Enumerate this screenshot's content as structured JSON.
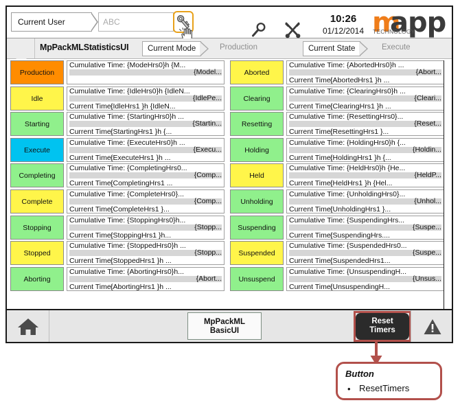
{
  "header": {
    "user_label": "Current User",
    "user_value": "",
    "user_placeholder": "ABC",
    "key_icon": "key-icon",
    "cursor_icon": "hand-cursor-icon",
    "search_icon": "magnifier-icon",
    "tools_icon": "wrench-tools-icon",
    "time": "10:26",
    "date": "01/12/2014",
    "logo_m": "m",
    "logo_app": "app",
    "logo_sub": "TECHNOLOGY"
  },
  "breadcrumb": {
    "screen_title": "MpPackMLStatisticsUI",
    "mode_tag": "Current Mode",
    "mode_value": "Production",
    "state_tag": "Current State",
    "state_value": "Execute"
  },
  "labels": {
    "cumulative": "Cumulative Time:",
    "current": "Current Time:"
  },
  "left_rows": [
    {
      "name": "Production",
      "color": "#FF8C00",
      "line1": "Cumulative Time: {ModeHrs0}h {M...",
      "bar_label": "{Model...",
      "line2_label": "",
      "line2_value": ""
    },
    {
      "name": "Idle",
      "color": "#FFF54A",
      "line1": "Cumulative Time: {IdleHrs0}h {IdleN...",
      "bar_label": "{IdlePe...",
      "line2_label": "Current Time:",
      "line2_value": "{IdleHrs1 }h {IdleN..."
    },
    {
      "name": "Starting",
      "color": "#90F08C",
      "line1": "Cumulative Time: {StartingHrs0}h ...",
      "bar_label": "{Startin...",
      "line2_label": "Current Time:",
      "line2_value": "{StartingHrs1 }h {..."
    },
    {
      "name": "Execute",
      "color": "#00C3F0",
      "line1": "Cumulative Time: {ExecuteHrs0}h ...",
      "bar_label": "{Execu...",
      "line2_label": "Current Time:",
      "line2_value": "{ExecuteHrs1 }h ..."
    },
    {
      "name": "Completing",
      "color": "#90F08C",
      "line1": "Cumulative Time: {CompletingHrs0...",
      "bar_label": "{Comp...",
      "line2_label": "Current Time:",
      "line2_value": "{CompletingHrs1 ..."
    },
    {
      "name": "Complete",
      "color": "#FFF54A",
      "line1": "Cumulative Time: {CompleteHrs0}...",
      "bar_label": "{Comp...",
      "line2_label": "Current Time:",
      "line2_value": "{CompleteHrs1 }..."
    },
    {
      "name": "Stopping",
      "color": "#90F08C",
      "line1": "Cumulative Time: {StoppingHrs0}h...",
      "bar_label": "{Stopp...",
      "line2_label": "Current Time:",
      "line2_value": "{StoppingHrs1 }h..."
    },
    {
      "name": "Stopped",
      "color": "#FFF54A",
      "line1": "Cumulative Time: {StoppedHrs0}h ...",
      "bar_label": "{Stopp...",
      "line2_label": "Current Time:",
      "line2_value": "{StoppedHrs1 }h ..."
    },
    {
      "name": "Aborting",
      "color": "#90F08C",
      "line1": "Cumulative Time: {AbortingHrs0}h...",
      "bar_label": "{Abort...",
      "line2_label": "Current Time:",
      "line2_value": "{AbortingHrs1 }h ..."
    }
  ],
  "right_rows": [
    {
      "name": "Aborted",
      "color": "#FFF54A",
      "line1": "Cumulative Time: {AbortedHrs0}h ...",
      "bar_label": "{Abort...",
      "line2_label": "Current Time:",
      "line2_value": "{AbortedHrs1 }h ..."
    },
    {
      "name": "Clearing",
      "color": "#90F08C",
      "line1": "Cumulative Time: {ClearingHrs0}h ...",
      "bar_label": "{Cleari...",
      "line2_label": "Current Time:",
      "line2_value": "{ClearingHrs1 }h ..."
    },
    {
      "name": "Resetting",
      "color": "#90F08C",
      "line1": "Cumulative Time: {ResettingHrs0}...",
      "bar_label": "{Reset...",
      "line2_label": "Current Time:",
      "line2_value": "{ResettingHrs1 }..."
    },
    {
      "name": "Holding",
      "color": "#90F08C",
      "line1": "Cumulative Time: {HoldingHrs0}h {...",
      "bar_label": "{Holdin...",
      "line2_label": "Current Time:",
      "line2_value": "{HoldingHrs1 }h {..."
    },
    {
      "name": "Held",
      "color": "#FFF54A",
      "line1": "Cumulative Time: {HeldHrs0}h {He...",
      "bar_label": "{HeldP...",
      "line2_label": "Current Time:",
      "line2_value": "{HeldHrs1 }h {Hel..."
    },
    {
      "name": "Unholding",
      "color": "#90F08C",
      "line1": "Cumulative Time: {UnholdingHrs0}...",
      "bar_label": "{Unhol...",
      "line2_label": "Current Time:",
      "line2_value": "{UnholdingHrs1 }..."
    },
    {
      "name": "Suspending",
      "color": "#90F08C",
      "line1": "Cumulative Time: {SuspendingHrs...",
      "bar_label": "{Suspe...",
      "line2_label": "Current Time:",
      "line2_value": "{SuspendingHrs...."
    },
    {
      "name": "Suspended",
      "color": "#FFF54A",
      "line1": "Cumulative Time: {SuspendedHrs0...",
      "bar_label": "{Suspe...",
      "line2_label": "Current Time:",
      "line2_value": "{SuspendedHrs1..."
    },
    {
      "name": "Unsuspend",
      "color": "#90F08C",
      "line1": "Cumulative Time: {UnsuspendingH...",
      "bar_label": "{Unsus...",
      "line2_label": "Current Time:",
      "line2_value": "{UnsuspendingH..."
    }
  ],
  "footer": {
    "home_icon": "home-icon",
    "basic_ui_line1": "MpPackML",
    "basic_ui_line2": "BasicUI",
    "reset_line1": "Reset",
    "reset_line2": "Timers",
    "warning_icon": "warning-triangle-icon"
  },
  "callout": {
    "title": "Button",
    "bullet": "•",
    "item": "ResetTimers",
    "accent_color": "#b2504b"
  }
}
